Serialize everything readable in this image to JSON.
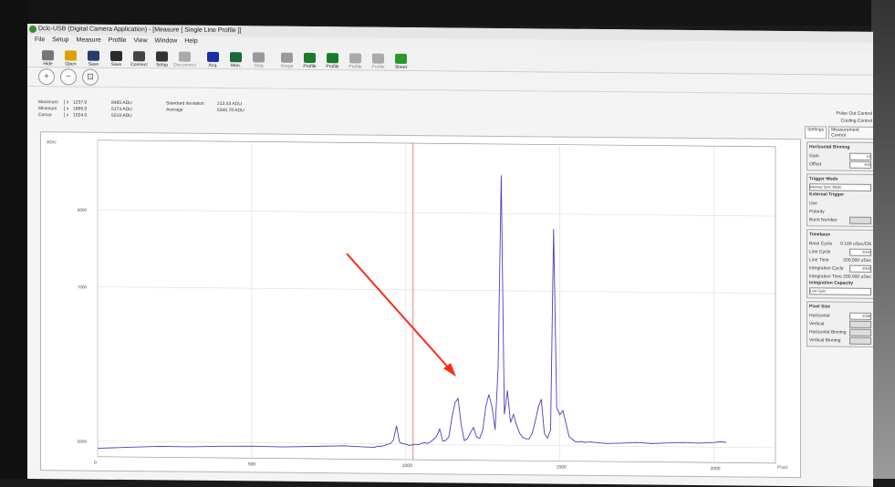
{
  "window": {
    "title": "Dclc-USB (Digital Camera Application) - [Measure [ Single Line Profile ]]"
  },
  "menu": [
    "File",
    "Setup",
    "Measure",
    "Profile",
    "View",
    "Window",
    "Help"
  ],
  "toolbar": [
    {
      "label": "Hide",
      "icon": "hide-icon",
      "color": "#777",
      "dim": false
    },
    {
      "label": "Open",
      "icon": "folder-icon",
      "color": "#d9a400",
      "dim": false
    },
    {
      "label": "Save",
      "icon": "save-icon",
      "color": "#2a3a6a",
      "dim": false
    },
    {
      "label": "Save",
      "icon": "save-image-icon",
      "color": "#2a2a2a",
      "dim": false
    },
    {
      "label": "Connect",
      "icon": "connect-icon",
      "color": "#444",
      "dim": false
    },
    {
      "label": "Setup",
      "icon": "setup-icon",
      "color": "#333",
      "dim": false
    },
    {
      "label": "Disconnect",
      "icon": "disconnect-icon",
      "color": "#aaa",
      "dim": true
    },
    {
      "label": "Acq.",
      "icon": "acquire-icon",
      "color": "#1a2fa0",
      "dim": false
    },
    {
      "label": "Mon.",
      "icon": "monitor-icon",
      "color": "#1a6a3a",
      "dim": false
    },
    {
      "label": "Stop",
      "icon": "stop-icon",
      "color": "#999",
      "dim": true
    },
    {
      "label": "Image",
      "icon": "image-icon",
      "color": "#9a9a9a",
      "dim": true
    },
    {
      "label": "Profile",
      "icon": "profile-icon",
      "color": "#1a7a2a",
      "dim": false
    },
    {
      "label": "Profile",
      "icon": "profile-icon",
      "color": "#1a7a2a",
      "dim": false
    },
    {
      "label": "Profile",
      "icon": "profile-icon",
      "color": "#aaa",
      "dim": true
    },
    {
      "label": "Profile",
      "icon": "profile-icon",
      "color": "#aaa",
      "dim": true
    },
    {
      "label": "Sheet",
      "icon": "sheet-icon",
      "color": "#2a9a2a",
      "dim": false
    }
  ],
  "stats": {
    "maximum": {
      "label": "Maximum",
      "x": "1237.0",
      "y": "8485 ADU"
    },
    "minimum": {
      "label": "Minimum",
      "x": "1686.0",
      "y": "5174 ADU"
    },
    "cursor": {
      "label": "Cursor",
      "x": "1024.0",
      "y": "5218 ADU"
    },
    "std_label": "Standard deviation",
    "std_value": "213.53 ADU",
    "avg_label": "Average",
    "avg_value": "5345.78 ADU"
  },
  "panel": {
    "headers": [
      "Pulse Out Control",
      "Cooling Control"
    ],
    "tabs": [
      "Settings",
      "Measurement Control"
    ],
    "binning": {
      "title": "Horizontal Binning",
      "gain_label": "Gain",
      "gain_value": "10",
      "offset_label": "Offset",
      "offset_value": "400"
    },
    "trigger": {
      "title": "Trigger Mode",
      "mode": "Internal Sync Mode"
    },
    "ext_trigger": {
      "title": "External Trigger",
      "use": "Use",
      "polarity": "Polarity",
      "burst": "Burst Number"
    },
    "timebase": {
      "title": "Timebase",
      "base_cycle": "Base Cycle",
      "base_cycle_value": "0.100 uSec/Clk",
      "line_cycle": "Line Cycle",
      "line_cycle_value": "2000",
      "line_time": "Line Time",
      "line_time_value": "200.000 uSec",
      "int_cycle": "Integration Cycle",
      "int_cycle_value": "2000",
      "int_time": "Integration Time",
      "int_time_value": "200.000 uSec"
    },
    "capacity": {
      "title": "Integration Capacity",
      "value": "Low Gain"
    },
    "pixel": {
      "title": "Pixel Size",
      "horizontal": "Horizontal",
      "horizontal_value": "2048",
      "vertical": "Vertical",
      "vertical_binning": "Horizontal Binning",
      "vertical_b": "Vertical Binning"
    }
  },
  "chart_data": {
    "type": "line",
    "ylabel": "ADU",
    "xlabel": "Pixel",
    "x_ticks": [
      "0",
      "500",
      "1000",
      "1500",
      "2000"
    ],
    "y_ticks": [
      "5000",
      "7000",
      "8000"
    ],
    "xlim": [
      0,
      2200
    ],
    "ylim": [
      4800,
      8900
    ],
    "cursor_x": 1024,
    "series": [
      {
        "color": "#4a3fc0",
        "points": [
          [
            0,
            4915
          ],
          [
            100,
            4925
          ],
          [
            200,
            4935
          ],
          [
            300,
            4945
          ],
          [
            400,
            4950
          ],
          [
            500,
            4950
          ],
          [
            600,
            4955
          ],
          [
            700,
            4960
          ],
          [
            800,
            4965
          ],
          [
            900,
            4960
          ],
          [
            900,
            4960
          ],
          [
            910,
            4965
          ],
          [
            920,
            4975
          ],
          [
            930,
            4980
          ],
          [
            940,
            4990
          ],
          [
            950,
            5010
          ],
          [
            960,
            5050
          ],
          [
            970,
            5230
          ],
          [
            980,
            5030
          ],
          [
            990,
            5005
          ],
          [
            1000,
            4995
          ],
          [
            1010,
            4990
          ],
          [
            1020,
            4990
          ],
          [
            1030,
            4995
          ],
          [
            1040,
            5000
          ],
          [
            1050,
            5010
          ],
          [
            1060,
            5015
          ],
          [
            1070,
            5020
          ],
          [
            1080,
            5030
          ],
          [
            1090,
            5060
          ],
          [
            1100,
            5110
          ],
          [
            1110,
            5200
          ],
          [
            1120,
            5040
          ],
          [
            1130,
            5060
          ],
          [
            1140,
            5100
          ],
          [
            1150,
            5350
          ],
          [
            1160,
            5550
          ],
          [
            1170,
            5600
          ],
          [
            1180,
            5250
          ],
          [
            1190,
            5060
          ],
          [
            1200,
            5080
          ],
          [
            1210,
            5150
          ],
          [
            1220,
            5230
          ],
          [
            1230,
            5100
          ],
          [
            1240,
            5080
          ],
          [
            1250,
            5200
          ],
          [
            1260,
            5500
          ],
          [
            1270,
            5650
          ],
          [
            1280,
            5500
          ],
          [
            1290,
            5200
          ],
          [
            1300,
            6000
          ],
          [
            1310,
            8500
          ],
          [
            1320,
            5400
          ],
          [
            1330,
            5700
          ],
          [
            1340,
            5300
          ],
          [
            1350,
            5400
          ],
          [
            1360,
            5250
          ],
          [
            1370,
            5160
          ],
          [
            1380,
            5100
          ],
          [
            1390,
            5080
          ],
          [
            1400,
            5090
          ],
          [
            1410,
            5150
          ],
          [
            1420,
            5300
          ],
          [
            1430,
            5500
          ],
          [
            1440,
            5600
          ],
          [
            1450,
            5150
          ],
          [
            1460,
            5100
          ],
          [
            1470,
            5200
          ],
          [
            1480,
            7800
          ],
          [
            1490,
            5500
          ],
          [
            1500,
            5400
          ],
          [
            1510,
            5450
          ],
          [
            1520,
            5300
          ],
          [
            1530,
            5120
          ],
          [
            1540,
            5080
          ],
          [
            1550,
            5060
          ],
          [
            1560,
            5050
          ],
          [
            1570,
            5050
          ],
          [
            1580,
            5050
          ],
          [
            1590,
            5050
          ],
          [
            1600,
            5045
          ],
          [
            1650,
            5040
          ],
          [
            1700,
            5040
          ],
          [
            1750,
            5045
          ],
          [
            1800,
            5045
          ],
          [
            1850,
            5048
          ],
          [
            1900,
            5050
          ],
          [
            1950,
            5055
          ],
          [
            2000,
            5060
          ],
          [
            2020,
            5065
          ],
          [
            2040,
            5070
          ]
        ]
      }
    ]
  }
}
